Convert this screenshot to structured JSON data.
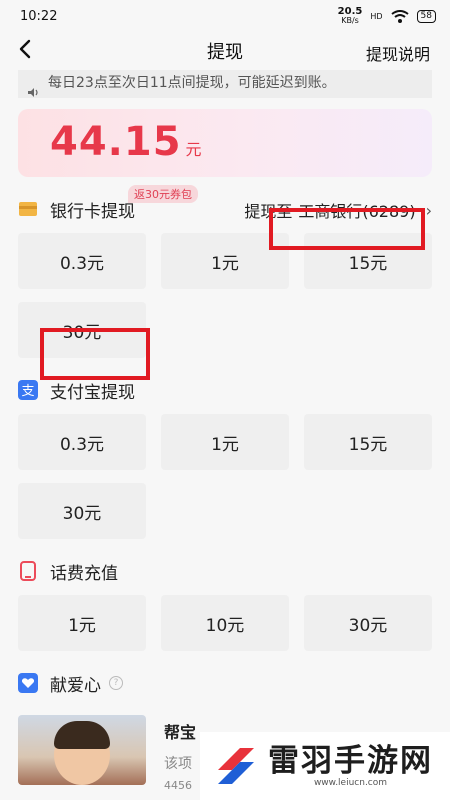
{
  "status": {
    "time": "10:22",
    "speed_value": "20.5",
    "speed_unit": "KB/s",
    "network": "HD",
    "battery": "58"
  },
  "nav": {
    "title": "提现",
    "help_label": "提现说明"
  },
  "notice": {
    "text": "每日23点至次日11点间提现，可能延迟到账。"
  },
  "balance": {
    "amount": "44.15",
    "unit": "元"
  },
  "bank_section": {
    "title": "银行卡提现",
    "badge": "返30元券包",
    "target_prefix": "提现至",
    "target_bank": "工商银行(6289)",
    "options": [
      "0.3元",
      "1元",
      "15元",
      "30元"
    ]
  },
  "alipay_section": {
    "title": "支付宝提现",
    "options": [
      "0.3元",
      "1元",
      "15元",
      "30元"
    ]
  },
  "phone_section": {
    "title": "话费充值",
    "options": [
      "1元",
      "10元",
      "30元"
    ]
  },
  "charity_section": {
    "title": "献爱心",
    "help_mark": "?",
    "item_title": "帮宝",
    "item_desc": "该项",
    "item_num": "4456"
  },
  "watermark": {
    "main": "雷羽手游网",
    "sub": "www.leiucn.com"
  },
  "colors": {
    "accent": "#e7384a",
    "highlight": "#e11a22",
    "bank_icon": "#f2b544",
    "alipay_icon": "#3a78f2",
    "phone_icon": "#ec4b5a",
    "love_icon": "#3a78f2"
  }
}
